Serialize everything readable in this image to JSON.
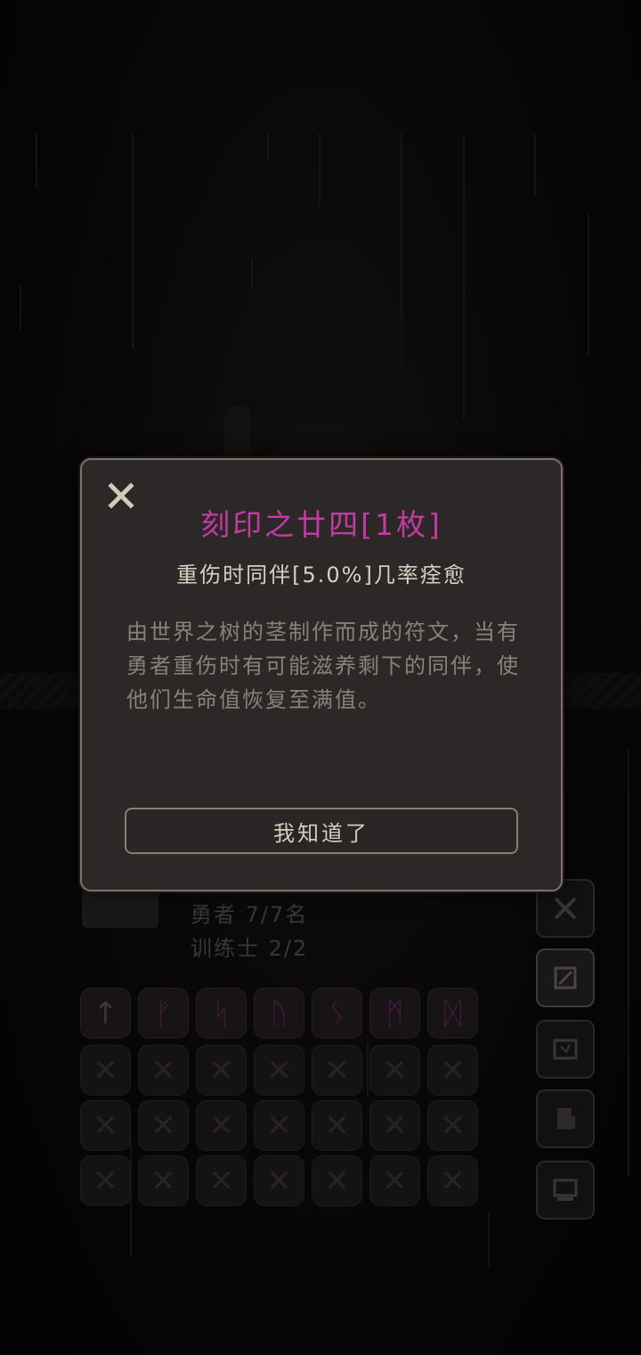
{
  "dialog": {
    "title": "刻印之廿四[1枚]",
    "subtitle": "重伤时同伴[5.0%]几率痊愈",
    "description": "由世界之树的茎制作而成的符文，当有勇者重伤时有可能滋养剩下的同伴，使他们生命值恢复至满值。",
    "confirm_label": "我知道了",
    "close_icon": "close-icon"
  },
  "party": {
    "heroes_label": "勇者 7/7名",
    "trainers_label": "训练士 2/2"
  },
  "runes": {
    "row1": [
      "↑",
      "ᚠ",
      "ᛋ",
      "ᚢ",
      "ᛊ",
      "ᛗ",
      "ᛞ"
    ],
    "empty_slot_glyph": "✕"
  },
  "side_menu": [
    "sword-icon",
    "scroll-icon",
    "map-icon",
    "document-icon",
    "computer-icon"
  ],
  "colors": {
    "title": "#c23ba3",
    "dialog_bg": "#2c2827",
    "dialog_border": "#7d7269"
  }
}
